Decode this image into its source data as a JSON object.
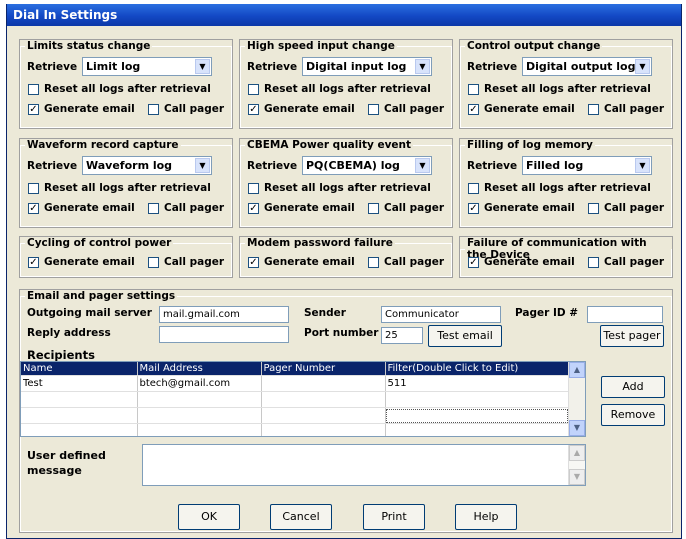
{
  "window": {
    "title": "Dial In Settings"
  },
  "groups": [
    {
      "title": "Limits status change",
      "retrieve_label": "Retrieve",
      "retrieve_value": "Limit log",
      "reset_label": "Reset all logs after retrieval",
      "reset_checked": false,
      "email_label": "Generate email",
      "email_checked": true,
      "pager_label": "Call pager",
      "pager_checked": false
    },
    {
      "title": "High speed input change",
      "retrieve_label": "Retrieve",
      "retrieve_value": "Digital input log",
      "reset_label": "Reset all logs after retrieval",
      "reset_checked": false,
      "email_label": "Generate email",
      "email_checked": true,
      "pager_label": "Call pager",
      "pager_checked": false
    },
    {
      "title": "Control output change",
      "retrieve_label": "Retrieve",
      "retrieve_value": "Digital output log",
      "reset_label": "Reset all logs after retrieval",
      "reset_checked": false,
      "email_label": "Generate email",
      "email_checked": true,
      "pager_label": "Call pager",
      "pager_checked": false
    },
    {
      "title": "Waveform record capture",
      "retrieve_label": "Retrieve",
      "retrieve_value": "Waveform log",
      "reset_label": "Reset all logs after retrieval",
      "reset_checked": false,
      "email_label": "Generate email",
      "email_checked": true,
      "pager_label": "Call pager",
      "pager_checked": false
    },
    {
      "title": "CBEMA Power quality event",
      "retrieve_label": "Retrieve",
      "retrieve_value": "PQ(CBEMA) log",
      "reset_label": "Reset all logs after retrieval",
      "reset_checked": false,
      "email_label": "Generate email",
      "email_checked": true,
      "pager_label": "Call pager",
      "pager_checked": false
    },
    {
      "title": "Filling of log memory",
      "retrieve_label": "Retrieve",
      "retrieve_value": "Filled log",
      "reset_label": "Reset all logs after retrieval",
      "reset_checked": false,
      "email_label": "Generate email",
      "email_checked": true,
      "pager_label": "Call pager",
      "pager_checked": false
    },
    {
      "title": "Cycling of control power",
      "email_label": "Generate email",
      "email_checked": true,
      "pager_label": "Call pager",
      "pager_checked": false
    },
    {
      "title": "Modem password failure",
      "email_label": "Generate email",
      "email_checked": true,
      "pager_label": "Call pager",
      "pager_checked": false
    },
    {
      "title": "Failure of communication with the Device",
      "email_label": "Generate email",
      "email_checked": true,
      "pager_label": "Call pager",
      "pager_checked": false
    }
  ],
  "email_settings": {
    "title": "Email and pager settings",
    "outgoing_label": "Outgoing mail server",
    "outgoing_value": "mail.gmail.com",
    "sender_label": "Sender",
    "sender_value": "Communicator",
    "pager_id_label": "Pager ID #",
    "pager_id_value": "",
    "reply_label": "Reply address",
    "reply_value": "",
    "port_label": "Port number",
    "port_value": "25",
    "test_email_label": "Test email",
    "test_pager_label": "Test pager"
  },
  "recipients": {
    "title": "Recipients",
    "columns": [
      "Name",
      "Mail Address",
      "Pager Number",
      "Filter(Double Click to Edit)"
    ],
    "rows": [
      [
        "Test",
        "btech@gmail.com",
        "",
        "511"
      ]
    ],
    "add_label": "Add",
    "remove_label": "Remove"
  },
  "message": {
    "label": "User defined message",
    "value": ""
  },
  "footer": {
    "ok_label": "OK",
    "cancel_label": "Cancel",
    "print_label": "Print",
    "help_label": "Help"
  },
  "check_mark": "✓",
  "arrow_glyph": "▼"
}
